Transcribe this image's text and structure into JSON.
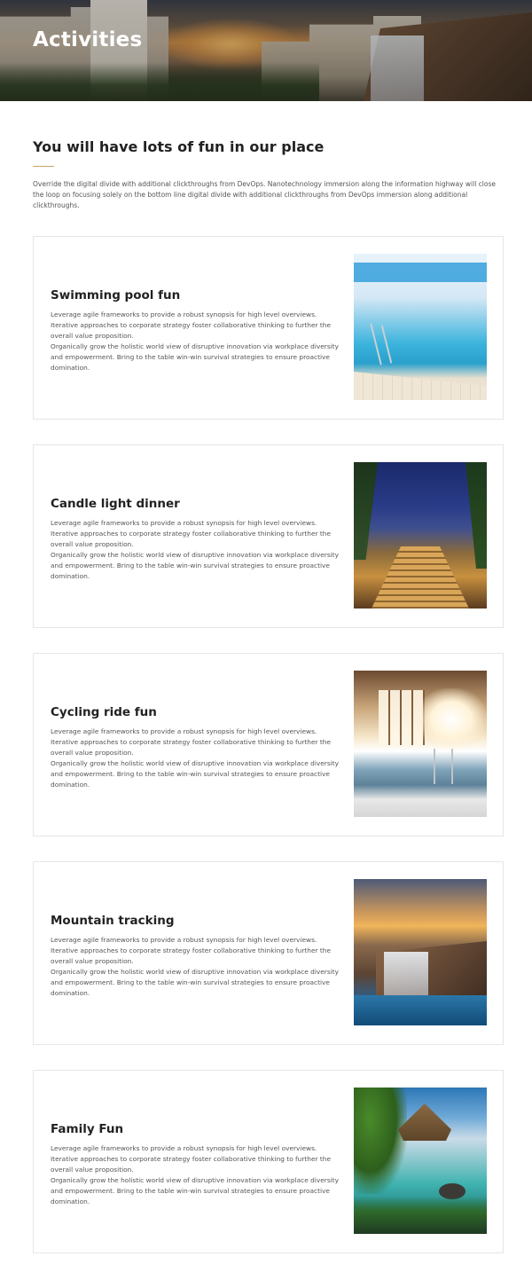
{
  "hero": {
    "title": "Activities"
  },
  "intro": {
    "heading": "You will have lots of fun in our place",
    "text": "Override the digital divide with additional clickthroughs from DevOps. Nanotechnology immersion along the information highway will close the loop on focusing solely on the bottom line digital divide with additional clickthroughs from DevOps immersion along additional clickthroughs."
  },
  "activities": [
    {
      "title": "Swimming pool fun",
      "text_1": "Leverage agile frameworks to provide a robust synopsis for high level overviews. Iterative approaches to corporate strategy foster collaborative thinking to further the overall value proposition.",
      "text_2": "Organically grow the holistic world view of disruptive innovation via workplace diversity and empowerment. Bring to the table win-win survival strategies to ensure proactive domination.",
      "image": "indoor-swimming-pool-photo"
    },
    {
      "title": "Candle light dinner",
      "text_1": "Leverage agile frameworks to provide a robust synopsis for high level overviews. Iterative approaches to corporate strategy foster collaborative thinking to further the overall value proposition.",
      "text_2": "Organically grow the holistic world view of disruptive innovation via workplace diversity and empowerment. Bring to the table win-win survival strategies to ensure proactive domination.",
      "image": "illuminated-stairway-night-photo"
    },
    {
      "title": "Cycling ride fun",
      "text_1": "Leverage agile frameworks to provide a robust synopsis for high level overviews. Iterative approaches to corporate strategy foster collaborative thinking to further the overall value proposition.",
      "text_2": "Organically grow the holistic world view of disruptive innovation via workplace diversity and empowerment. Bring to the table win-win survival strategies to ensure proactive domination.",
      "image": "sunlit-indoor-pool-photo"
    },
    {
      "title": "Mountain tracking",
      "text_1": "Leverage agile frameworks to provide a robust synopsis for high level overviews. Iterative approaches to corporate strategy foster collaborative thinking to further the overall value proposition.",
      "text_2": "Organically grow the holistic world view of disruptive innovation via workplace diversity and empowerment. Bring to the table win-win survival strategies to ensure proactive domination.",
      "image": "sunset-waterfall-rocks-photo"
    },
    {
      "title": "Family Fun",
      "text_1": "Leverage agile frameworks to provide a robust synopsis for high level overviews. Iterative approaches to corporate strategy foster collaborative thinking to further the overall value proposition.",
      "text_2": "Organically grow the holistic world view of disruptive innovation via workplace diversity and empowerment. Bring to the table win-win survival strategies to ensure proactive domination.",
      "image": "tropical-lagoon-hut-photo"
    }
  ],
  "colors": {
    "accent": "#c6a16a",
    "heading": "#222222",
    "body_text": "#555555",
    "card_border": "#e6e6e6"
  }
}
